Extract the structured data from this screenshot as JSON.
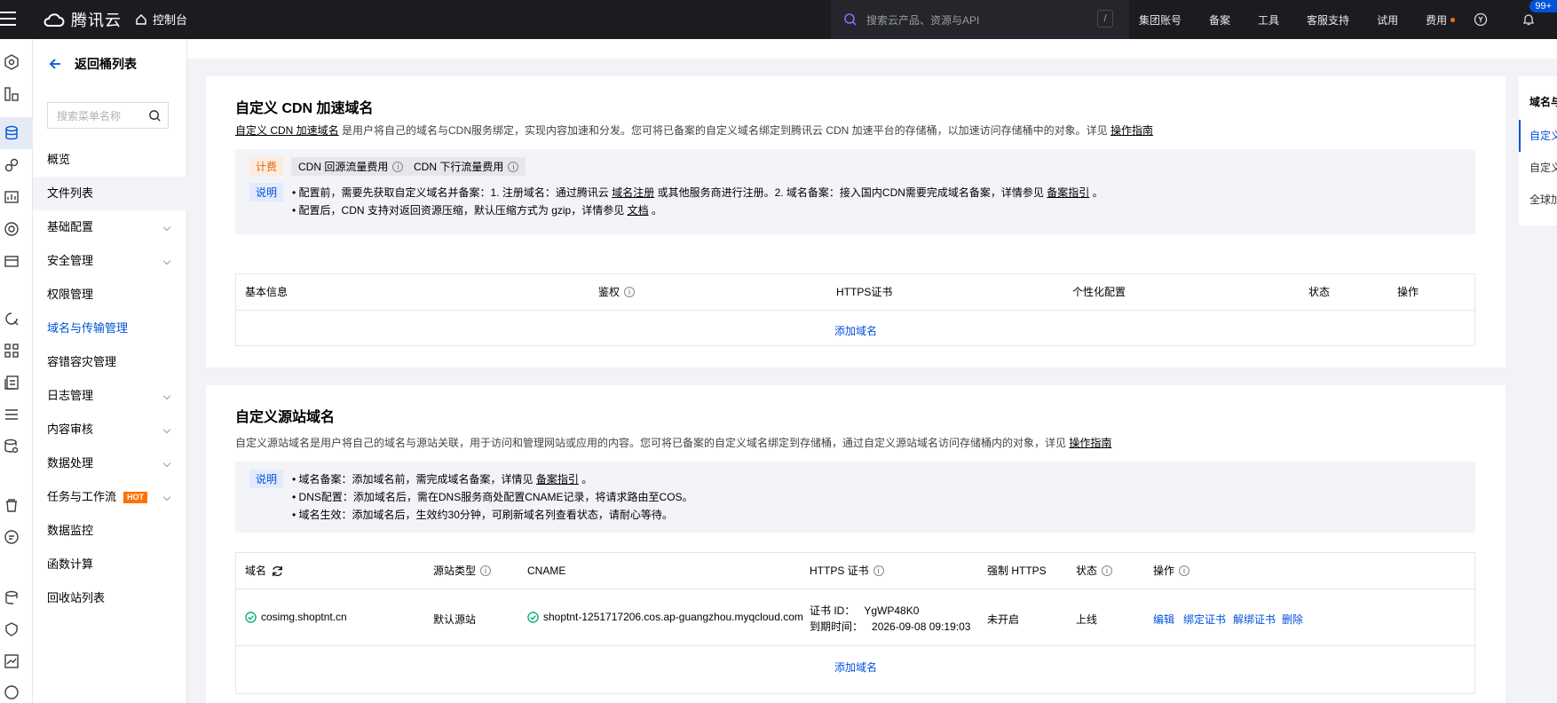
{
  "topbar": {
    "brand": "腾讯云",
    "console": "控制台",
    "search_placeholder": "搜索云产品、资源与API",
    "search_shortcut": "/",
    "nav": [
      "集团账号",
      "备案",
      "工具",
      "客服支持",
      "试用",
      "费用"
    ],
    "badge": "99+"
  },
  "sidebar": {
    "back_label": "返回桶列表",
    "search_placeholder": "搜索菜单名称",
    "items": [
      {
        "label": "概览",
        "expandable": false
      },
      {
        "label": "文件列表",
        "expandable": false
      },
      {
        "label": "基础配置",
        "expandable": true
      },
      {
        "label": "安全管理",
        "expandable": true
      },
      {
        "label": "权限管理",
        "expandable": false
      },
      {
        "label": "域名与传输管理",
        "expandable": false
      },
      {
        "label": "容错容灾管理",
        "expandable": false
      },
      {
        "label": "日志管理",
        "expandable": true
      },
      {
        "label": "内容审核",
        "expandable": true
      },
      {
        "label": "数据处理",
        "expandable": true
      },
      {
        "label": "任务与工作流",
        "expandable": true,
        "tag": "HOT"
      },
      {
        "label": "数据监控",
        "expandable": false
      },
      {
        "label": "函数计算",
        "expandable": false
      },
      {
        "label": "回收站列表",
        "expandable": false
      }
    ]
  },
  "cdn": {
    "title": "自定义 CDN 加速域名",
    "desc_link": "自定义 CDN 加速域名",
    "desc_text": " 是用户将自己的域名与CDN服务绑定，实现内容加速和分发。您可将已备案的自定义域名绑定到腾讯云 CDN 加速平台的存储桶，以加速访问存储桶中的对象。详见 ",
    "desc_guide": "操作指南",
    "fee_tag": "计费",
    "fee_chip1": "CDN 回源流量费用",
    "fee_chip2": "CDN 下行流量费用",
    "note_tag": "说明",
    "note1_a": "• 配置前，需要先获取自定义域名并备案：1. 注册域名：通过腾讯云 ",
    "note1_link1": "域名注册",
    "note1_b": " 或其他服务商进行注册。2. 域名备案：接入国内CDN需要完成域名备案，详情参见 ",
    "note1_link2": "备案指引",
    "note1_c": " 。",
    "note2_a": "• 配置后，CDN 支持对返回资源压缩，默认压缩方式为 gzip，详情参见 ",
    "note2_link": "文档",
    "note2_b": " 。",
    "columns": [
      "基本信息",
      "鉴权",
      "HTTPS证书",
      "个性化配置",
      "状态",
      "操作"
    ],
    "add_label": "添加域名"
  },
  "origin": {
    "title": "自定义源站域名",
    "desc_text": "自定义源站域名是用户将自己的域名与源站关联，用于访问和管理网站或应用的内容。您可将已备案的自定义域名绑定到存储桶，通过自定义源站域名访问存储桶内的对象，详见 ",
    "desc_guide": "操作指南",
    "note_tag": "说明",
    "note1_a": "• 域名备案：添加域名前，需完成域名备案，详情见 ",
    "note1_link": "备案指引",
    "note1_b": " 。",
    "note2": "• DNS配置：添加域名后，需在DNS服务商处配置CNAME记录，将请求路由至COS。",
    "note3": "• 域名生效：添加域名后，生效约30分钟，可刷新域名列查看状态，请耐心等待。",
    "columns": [
      "域名",
      "源站类型",
      "CNAME",
      "HTTPS 证书",
      "强制 HTTPS",
      "状态",
      "操作"
    ],
    "row": {
      "domain": "cosimg.shoptnt.cn",
      "origin_type": "默认源站",
      "cname": "shoptnt-1251717206.cos.ap-guangzhou.myqcloud.com",
      "cert_id_label": "证书 ID：",
      "cert_id": "YgWP48K0",
      "expire_label": "到期时间：",
      "expire": "2026-09-08 09:19:03",
      "force_https": "未开启",
      "status": "上线",
      "actions": [
        "编辑",
        "绑定证书",
        "解绑证书",
        "删除"
      ]
    },
    "add_label": "添加域名"
  },
  "anchor": {
    "items": [
      "域名与",
      "自定义",
      "自定义",
      "全球加"
    ]
  }
}
